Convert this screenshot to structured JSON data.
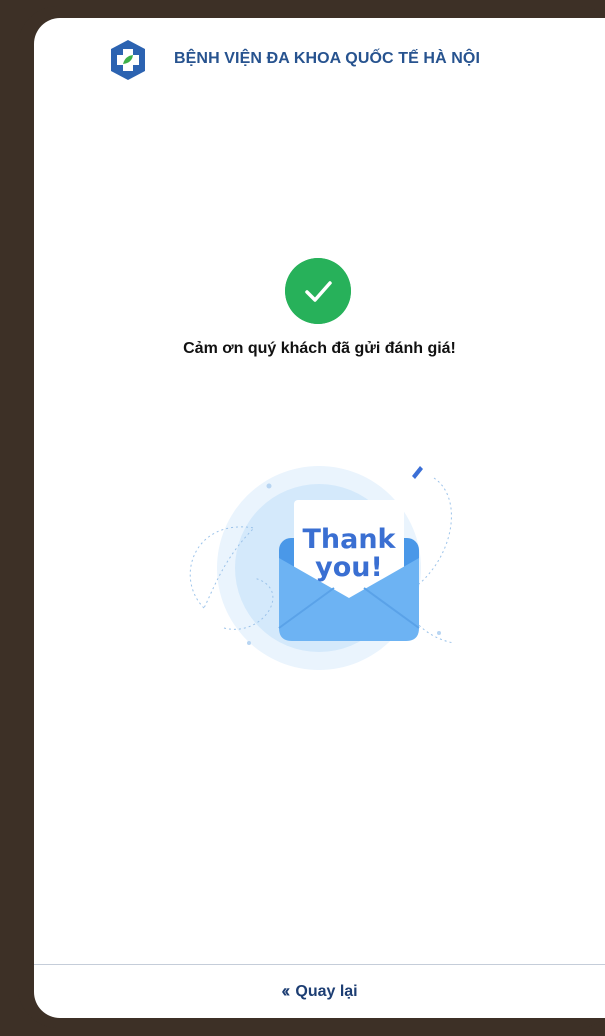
{
  "header": {
    "logo_icon": "hospital-cross-logo",
    "title": "BỆNH VIỆN ĐA KHOA QUỐC TẾ HÀ NỘI"
  },
  "main": {
    "success_icon": "checkmark-icon",
    "message": "Cảm ơn quý khách đã gửi đánh giá!",
    "card": {
      "line1": "Thank",
      "line2": "you!"
    }
  },
  "footer": {
    "back_icon": "double-chevron-left-icon",
    "back_label": "Quay lại"
  },
  "colors": {
    "brand_blue": "#27538f",
    "success_green": "#27b15a",
    "envelope_blue": "#5ea8ef",
    "frame_brown": "#3d3026"
  }
}
